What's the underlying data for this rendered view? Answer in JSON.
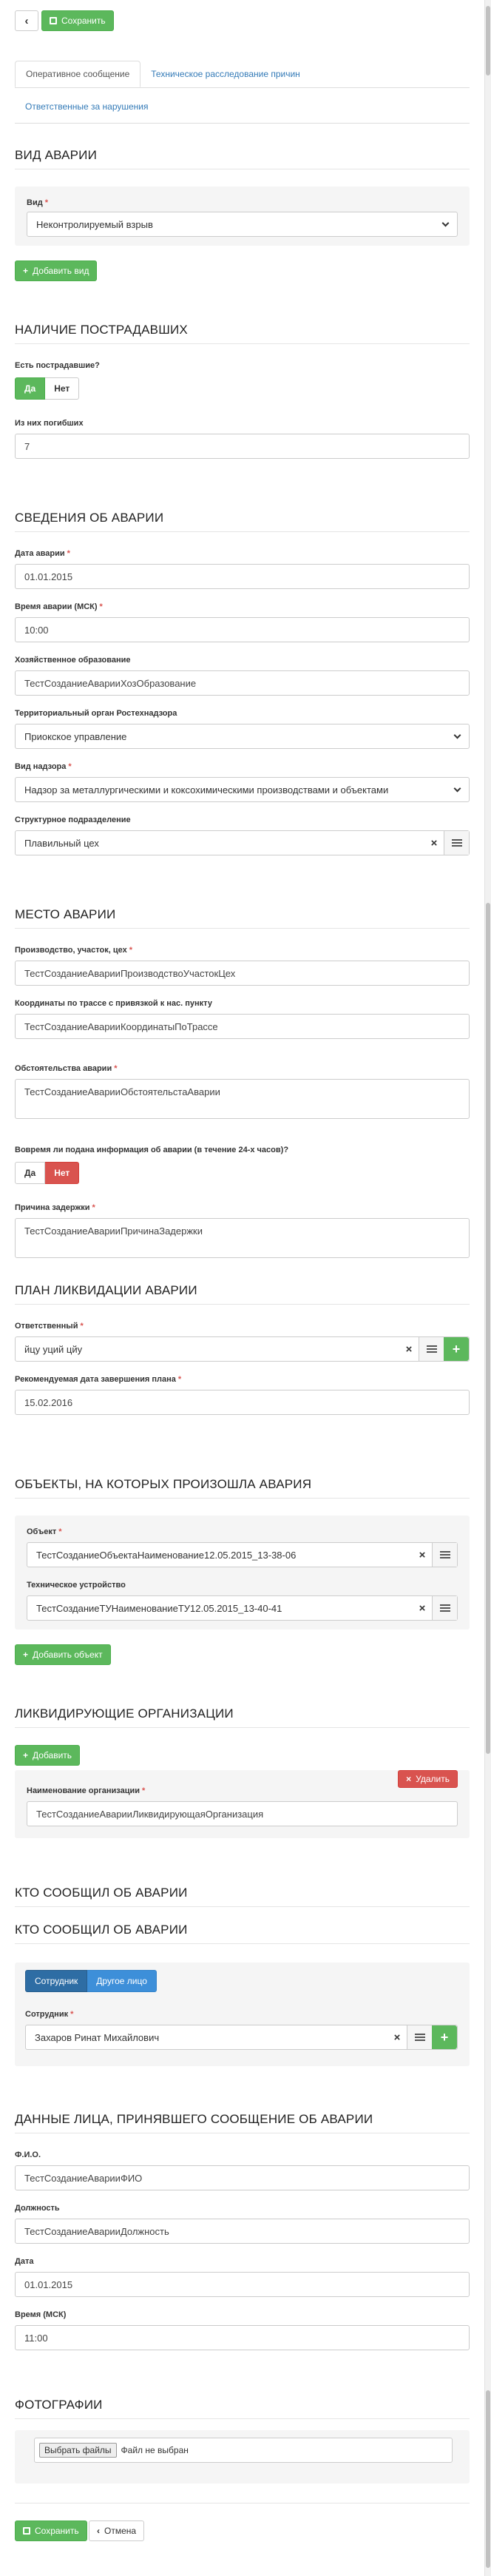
{
  "toolbar": {
    "back_icon": "arrow-left-icon",
    "save_label": "Сохранить"
  },
  "tabs": {
    "items": [
      {
        "label": "Оперативное сообщение"
      },
      {
        "label": "Техническое расследование причин"
      },
      {
        "label": "Ответственные за нарушения"
      }
    ]
  },
  "accident_type": {
    "title": "ВИД АВАРИИ",
    "type_label": "Вид",
    "type_value": "Неконтролируемый взрыв",
    "add_label": "Добавить вид"
  },
  "victims": {
    "title": "НАЛИЧИЕ ПОСТРАДАВШИХ",
    "has_label": "Есть пострадавшие?",
    "yes": "Да",
    "no": "Нет",
    "dead_label": "Из них погибших",
    "dead_value": "7"
  },
  "info": {
    "title": "СВЕДЕНИЯ ОБ АВАРИИ",
    "date_label": "Дата аварии",
    "date_value": "01.01.2015",
    "time_label": "Время аварии (МСК)",
    "time_value": "10:00",
    "econ_label": "Хозяйственное образование",
    "econ_value": "ТестСозданиеАварииХозОбразование",
    "terr_label": "Территориальный орган Ростехнадзора",
    "terr_value": "Приокское управление",
    "supervision_label": "Вид надзора",
    "supervision_value": "Надзор за металлургическими и коксохимическими производствами и объектами",
    "division_label": "Структурное подразделение",
    "division_value": "Плавильный цех"
  },
  "place": {
    "title": "МЕСТО АВАРИИ",
    "prod_label": "Производство, участок, цех",
    "prod_value": "ТестСозданиеАварииПроизводствоУчастокЦех",
    "coords_label": "Координаты по трассе с привязкой к нас. пункту",
    "coords_value": "ТестСозданиеАварииКоординатыПоТрассе",
    "circ_label": "Обстоятельства аварии",
    "circ_value": "ТестСозданиеАварииОбстоятельстаАварии",
    "timely_label": "Вовремя ли подана информация об аварии (в течение 24-х часов)?",
    "yes": "Да",
    "no": "Нет",
    "delay_label": "Причина задержки",
    "delay_value": "ТестСозданиеАварииПричинаЗадержки"
  },
  "plan": {
    "title": "ПЛАН ЛИКВИДАЦИИ АВАРИИ",
    "resp_label": "Ответственный",
    "resp_value": "йцу уций цйу",
    "date_label": "Рекомендуемая дата завершения плана",
    "date_value": "15.02.2016"
  },
  "objects": {
    "title": "ОБЪЕКТЫ, НА КОТОРЫХ ПРОИЗОШЛА АВАРИЯ",
    "object_label": "Объект",
    "object_value": "ТестСозданиеОбъектаНаименование12.05.2015_13-38-06",
    "device_label": "Техническое устройство",
    "device_value": "ТестСозданиеТУНаименованиеТУ12.05.2015_13-40-41",
    "add_label": "Добавить объект"
  },
  "liquidators": {
    "title": "ЛИКВИДИРУЮЩИЕ ОРГАНИЗАЦИИ",
    "add_label": "Добавить",
    "delete_label": "Удалить",
    "org_label": "Наименование организации",
    "org_value": "ТестСозданиеАварииЛиквидирующаяОрганизация"
  },
  "reporter": {
    "title": "КТО СООБЩИЛ ОБ АВАРИИ",
    "subtitle": "КТО СООБЩИЛ ОБ АВАРИИ",
    "employee_tab": "Сотрудник",
    "other_tab": "Другое лицо",
    "employee_label": "Сотрудник",
    "employee_value": "Захаров Ринат Михайлович"
  },
  "receiver": {
    "title": "ДАННЫЕ ЛИЦА, ПРИНЯВШЕГО СООБЩЕНИЕ ОБ АВАРИИ",
    "fio_label": "Ф.И.О.",
    "fio_value": "ТестСозданиеАварииФИО",
    "pos_label": "Должность",
    "pos_value": "ТестСозданиеАварииДолжность",
    "date_label": "Дата",
    "date_value": "01.01.2015",
    "time_label": "Время (МСК)",
    "time_value": "11:00"
  },
  "photos": {
    "title": "ФОТОГРАФИИ",
    "choose_label": "Выбрать файлы",
    "no_file_label": "Файл не выбран"
  },
  "footer": {
    "save_label": "Сохранить",
    "cancel_label": "Отмена"
  },
  "colors": {
    "green": "#5cb85c",
    "red": "#d9534f",
    "blue": "#337ab7"
  }
}
